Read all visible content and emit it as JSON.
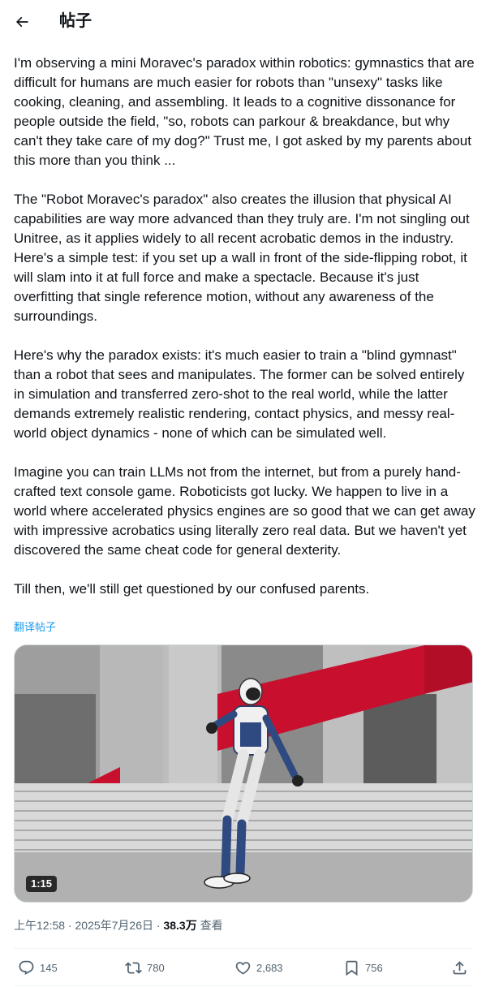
{
  "header": {
    "title": "帖子",
    "back_icon": "arrow-left-icon"
  },
  "post": {
    "paragraphs": [
      "I'm observing a mini Moravec's paradox within robotics: gymnastics that are difficult for humans are much easier for robots than \"unsexy\" tasks like cooking, cleaning, and assembling. It leads to a cognitive dissonance for people outside the field, \"so, robots can parkour & breakdance, but why can't they take care of my dog?\" Trust me, I got asked by my parents about this more than you think ...",
      "The \"Robot Moravec's paradox\" also creates the illusion that physical AI capabilities are way more advanced than they truly are. I'm not singling out Unitree, as it applies widely to all recent acrobatic demos in the industry. Here's a simple test: if you set up a wall in front of the side-flipping robot, it will slam into it at full force and make a spectacle. Because it's just overfitting that single reference motion, without any awareness of the surroundings.",
      "Here's why the paradox exists: it's much easier to train a \"blind gymnast\" than a robot that sees and manipulates. The former can be solved entirely in simulation and transferred zero-shot to the real world, while the latter demands extremely realistic rendering, contact physics, and messy real-world object dynamics - none of which can be simulated well.",
      "Imagine you can train LLMs not from the internet, but from a purely hand-crafted text console game. Roboticists got lucky. We happen to live in a world where accelerated physics engines are so good that we can get away with impressive acrobatics using literally zero real data. But we haven't yet discovered the same cheat code for general dexterity.",
      "Till then, we'll still get questioned by our confused parents."
    ],
    "translate_label": "翻译帖子",
    "video": {
      "duration": "1:15"
    },
    "time": "上午12:58",
    "separator": " · ",
    "date": "2025年7月26日",
    "views_count": "38.3万",
    "views_label": " 查看"
  },
  "actions": {
    "replies": {
      "icon": "reply-icon",
      "count": "145"
    },
    "reposts": {
      "icon": "repost-icon",
      "count": "780"
    },
    "likes": {
      "icon": "heart-icon",
      "count": "2,683"
    },
    "bookmarks": {
      "icon": "bookmark-icon",
      "count": "756"
    },
    "share": {
      "icon": "share-icon"
    }
  },
  "colors": {
    "link": "#1d9bf0",
    "secondary_text": "#536471",
    "primary_text": "#0f1419",
    "divider": "#eff3f4"
  }
}
